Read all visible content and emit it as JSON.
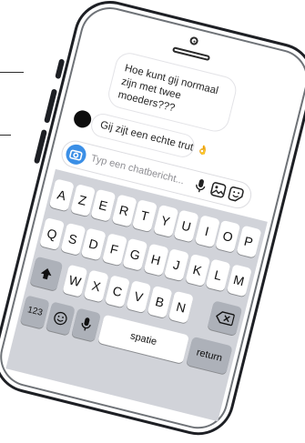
{
  "chat": {
    "received_message": "Hoe kunt gij normaal zijn met twee moeders???",
    "sent_message": "Gij zijt een echte trut",
    "sent_emoji": "👌"
  },
  "composer": {
    "placeholder": "Typ een chatbericht..."
  },
  "keyboard": {
    "row1": [
      "A",
      "Z",
      "E",
      "R",
      "T",
      "Y",
      "U",
      "I",
      "O",
      "P"
    ],
    "row2": [
      "Q",
      "S",
      "D",
      "F",
      "G",
      "H",
      "J",
      "K",
      "L",
      "M"
    ],
    "row3": [
      "W",
      "X",
      "C",
      "V",
      "B",
      "N"
    ],
    "numbers_key": "123",
    "space_key": "spatie",
    "return_key": "return"
  },
  "icons": {
    "camera": "camera-icon",
    "mic": "microphone-icon",
    "gallery": "image-icon",
    "sticker": "sticker-icon",
    "shift": "shift-icon",
    "backspace": "backspace-icon",
    "emoji": "emoji-icon",
    "dictation": "microphone-icon"
  },
  "colors": {
    "accent": "#3b8fe6",
    "keyboard_bg": "#d1d3d9",
    "phone_frame": "#1d1f24"
  }
}
